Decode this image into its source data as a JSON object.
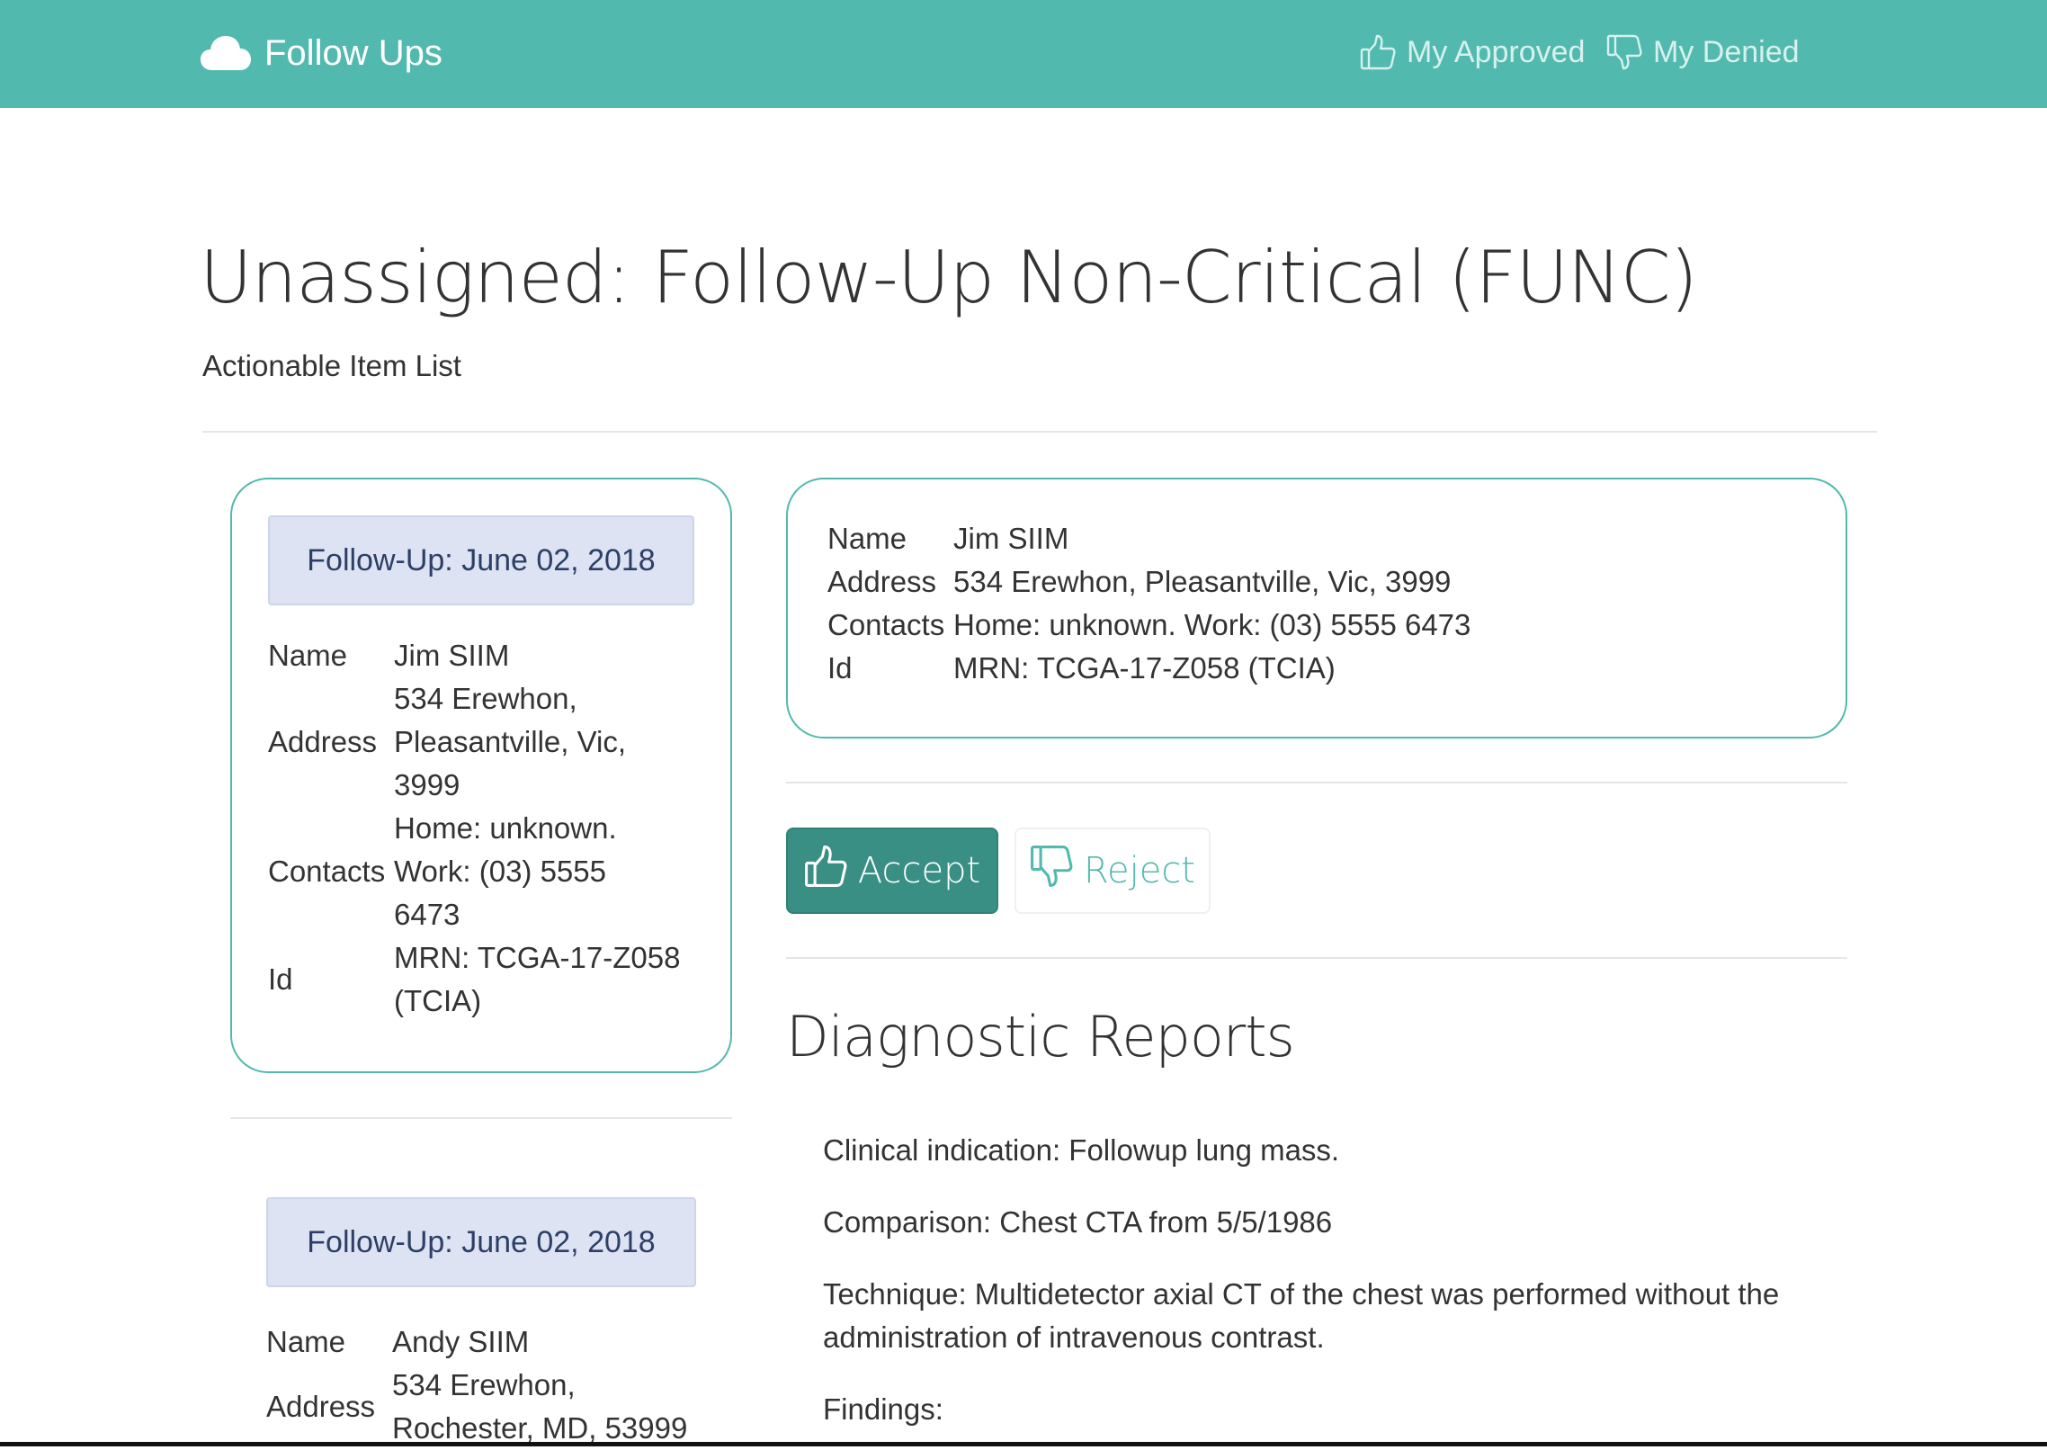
{
  "navbar": {
    "brand_label": "Follow Ups",
    "approved_label": "My Approved",
    "denied_label": "My Denied",
    "background_color": "#52b9ae",
    "brand_icon": "cloud-icon",
    "approved_icon": "thumbs-up-icon",
    "denied_icon": "thumbs-down-icon"
  },
  "page": {
    "title": "Unassigned: Follow-Up Non-Critical (FUNC)",
    "subtitle": "Actionable Item List"
  },
  "followups": [
    {
      "date_label": "Follow-Up: June 02, 2018",
      "fields": {
        "name_label": "Name",
        "name_first": "Jim",
        "name_last": "SIIM",
        "address_label": "Address",
        "address_lines": [
          "534 Erewhon,",
          "Pleasantville, Vic,",
          "3999"
        ],
        "contacts_label": "Contacts",
        "contacts_lines": [
          "Home: unknown.",
          "Work: (03) 5555",
          "6473"
        ],
        "id_label": "Id",
        "id_lines": [
          "MRN: TCGA-17-Z058",
          "(TCIA)"
        ]
      }
    },
    {
      "date_label": "Follow-Up: June 02, 2018",
      "fields": {
        "name_label": "Name",
        "name_value": "Andy SIIM",
        "address_label": "Address",
        "address_lines": [
          "534 Erewhon,",
          "Rochester, MD, 53999"
        ]
      }
    }
  ],
  "detail": {
    "name_label": "Name",
    "name_first": "Jim",
    "name_last": "SIIM",
    "address_label": "Address",
    "address_value": "534 Erewhon, Pleasantville, Vic, 3999",
    "contacts_label": "Contacts",
    "contacts_value": "Home: unknown. Work: (03) 5555 6473",
    "id_label": "Id",
    "id_value": "MRN: TCGA-17-Z058 (TCIA)"
  },
  "actions": {
    "accept_label": "Accept",
    "reject_label": "Reject",
    "accept_color": "#3a8f84",
    "reject_color": "#52b9ae"
  },
  "reports": {
    "title": "Diagnostic Reports",
    "paragraphs": [
      "Clinical indication: Followup lung mass.",
      "Comparison: Chest CTA from 5/5/1986",
      "Technique: Multidetector axial CT of the chest was performed without the administration of intravenous contrast.",
      "Findings:"
    ]
  }
}
